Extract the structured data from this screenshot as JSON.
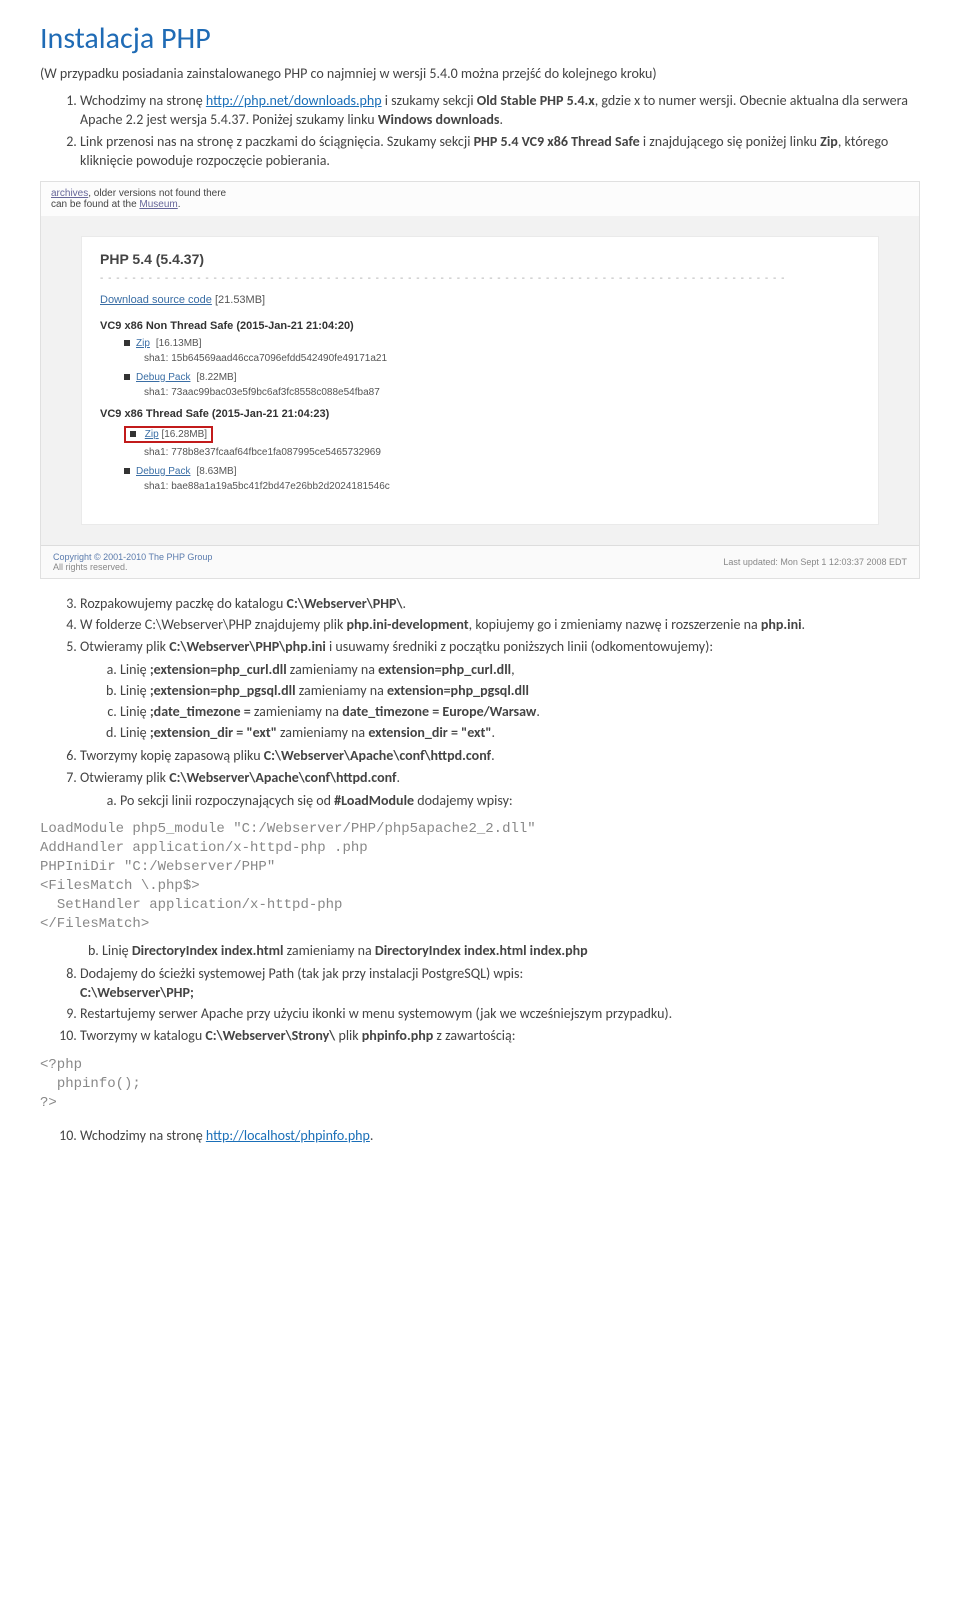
{
  "title": "Instalacja PHP",
  "intro": "(W przypadku posiadania zainstalowanego PHP co najmniej w wersji 5.4.0 można przejść do kolejnego kroku)",
  "step1_a": "Wchodzimy na stronę ",
  "step1_link": "http://php.net/downloads.php",
  "step1_b": " i szukamy sekcji ",
  "step1_c": "Old Stable PHP 5.4.x",
  "step1_d": ", gdzie x to numer wersji. Obecnie aktualna dla serwera Apache 2.2 jest wersja 5.4.37. Poniżej szukamy linku ",
  "step1_e": "Windows downloads",
  "step1_f": ".",
  "step2_a": "Link przenosi nas na stronę z paczkami do ściągnięcia. Szukamy sekcji ",
  "step2_b": "PHP 5.4 VC9 x86 Thread Safe",
  "step2_c": " i znajdującego się poniżej linku ",
  "step2_d": "Zip",
  "step2_e": ", którego kliknięcie powoduje rozpoczęcie pobierania.",
  "ss": {
    "top_a": "archives",
    "top_b": ", older versions not found there",
    "top_c": "can be found at the ",
    "top_d": "Museum",
    "top_e": ".",
    "card_title": "PHP 5.4 (5.4.37)",
    "source_link": "Download source code",
    "source_size": "[21.53MB]",
    "nts_head": "VC9 x86 Non Thread Safe (2015-Jan-21 21:04:20)",
    "nts_zip": "Zip",
    "nts_zip_size": "[16.13MB]",
    "nts_zip_sha": "sha1: 15b64569aad46cca7096efdd542490fe49171a21",
    "nts_dbg": "Debug Pack",
    "nts_dbg_size": "[8.22MB]",
    "nts_dbg_sha": "sha1: 73aac99bac03e5f9bc6af3fc8558c088e54fba87",
    "ts_head": "VC9 x86 Thread Safe (2015-Jan-21 21:04:23)",
    "ts_zip": "Zip",
    "ts_zip_size": "[16.28MB]",
    "ts_zip_sha": "sha1: 778b8e37fcaaf64fbce1fa087995ce5465732969",
    "ts_dbg": "Debug Pack",
    "ts_dbg_size": "[8.63MB]",
    "ts_dbg_sha": "sha1: bae88a1a19a5bc41f2bd47e26bb2d2024181546c",
    "copyright": "Copyright © 2001-2010 The PHP Group",
    "rights": "All rights reserved.",
    "lastup": "Last updated: Mon Sept 1 12:03:37 2008 EDT"
  },
  "step3_a": "Rozpakowujemy paczkę do katalogu ",
  "step3_b": "C:\\Webserver\\PHP\\",
  "step3_c": ".",
  "step4_a": "W folderze C:\\Webserver\\PHP znajdujemy plik ",
  "step4_b": "php.ini-development",
  "step4_c": ", kopiujemy go i zmieniamy nazwę i rozszerzenie na ",
  "step4_d": "php.ini",
  "step4_e": ".",
  "step5_a": "Otwieramy plik ",
  "step5_b": "C:\\Webserver\\PHP\\php.ini",
  "step5_c": " i usuwamy średniki  z początku poniższych linii (odkomentowujemy):",
  "step5a_a": "Linię ",
  "step5a_b": ";extension=php_curl.dll",
  "step5a_c": " zamieniamy na ",
  "step5a_d": "extension=php_curl.dll",
  "step5a_e": ",",
  "step5b_a": "Linię ",
  "step5b_b": ";extension=php_pgsql.dll",
  "step5b_c": " zamieniamy na ",
  "step5b_d": "extension=php_pgsql.dll",
  "step5c_a": "Linię ",
  "step5c_b": ";date_timezone =",
  "step5c_c": " zamieniamy na ",
  "step5c_d": "date_timezone = Europe/Warsaw",
  "step5c_e": ".",
  "step5d_a": "Linię ",
  "step5d_b": ";extension_dir = \"ext\"",
  "step5d_c": " zamieniamy na ",
  "step5d_d": "extension_dir = \"ext\"",
  "step5d_e": ".",
  "step6_a": "Tworzymy kopię zapasową pliku ",
  "step6_b": "C:\\Webserver\\Apache\\conf\\httpd.conf",
  "step6_c": ".",
  "step7_a": "Otwieramy plik ",
  "step7_b": "C:\\Webserver\\Apache\\conf\\httpd.conf",
  "step7_c": ".",
  "step7a_a": "Po sekcji linii rozpoczynających się od ",
  "step7a_b": "#LoadModule",
  "step7a_c": " dodajemy wpisy:",
  "code1": "LoadModule php5_module \"C:/Webserver/PHP/php5apache2_2.dll\"\nAddHandler application/x-httpd-php .php\nPHPIniDir \"C:/Webserver/PHP\"\n<FilesMatch \\.php$>\n  SetHandler application/x-httpd-php\n</FilesMatch>",
  "step7b_a": "Linię ",
  "step7b_b": "DirectoryIndex index.html",
  "step7b_c": " zamieniamy na ",
  "step7b_d": "DirectoryIndex index.html index.php",
  "step8_a": "Dodajemy do ścieżki systemowej Path (tak jak przy instalacji PostgreSQL) wpis:",
  "step8_b": "C:\\Webserver\\PHP;",
  "step9": "Restartujemy serwer Apache przy użyciu ikonki w menu systemowym (jak we wcześniejszym przypadku).",
  "step10_a": "Tworzymy w katalogu ",
  "step10_b": "C:\\Webserver\\Strony\\",
  "step10_c": " plik ",
  "step10_d": "phpinfo.php",
  "step10_e": " z zawartością:",
  "code2": "<?php\n  phpinfo();\n?>",
  "step10b_a": "Wchodzimy na stronę ",
  "step10b_link": "http://localhost/phpinfo.php",
  "step10b_c": "."
}
